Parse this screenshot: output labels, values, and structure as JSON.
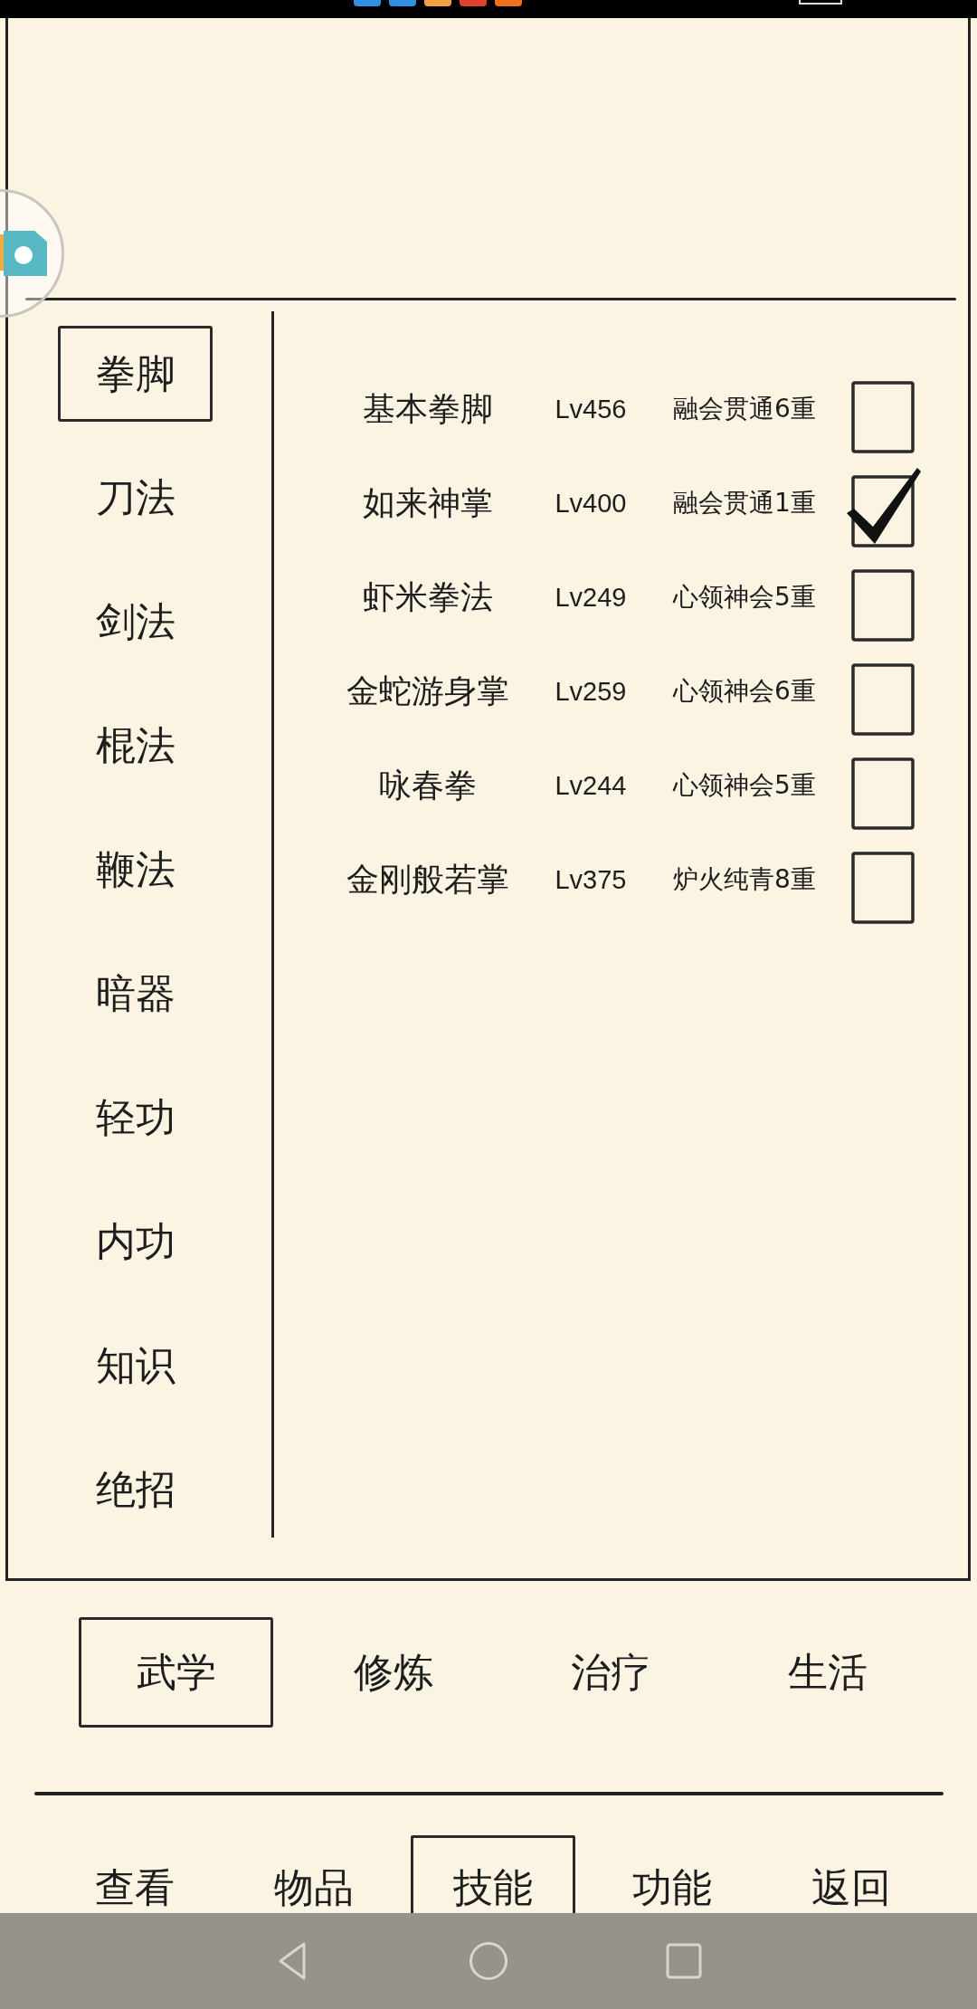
{
  "sidebar": {
    "items": [
      {
        "label": "拳脚",
        "selected": true
      },
      {
        "label": "刀法",
        "selected": false
      },
      {
        "label": "剑法",
        "selected": false
      },
      {
        "label": "棍法",
        "selected": false
      },
      {
        "label": "鞭法",
        "selected": false
      },
      {
        "label": "暗器",
        "selected": false
      },
      {
        "label": "轻功",
        "selected": false
      },
      {
        "label": "内功",
        "selected": false
      },
      {
        "label": "知识",
        "selected": false
      },
      {
        "label": "绝招",
        "selected": false
      }
    ]
  },
  "skills": [
    {
      "name": "基本拳脚",
      "grade": "Lv456",
      "mastery": "融会贯通6重",
      "checked": false
    },
    {
      "name": "如来神掌",
      "grade": "Lv400",
      "mastery": "融会贯通1重",
      "checked": true
    },
    {
      "name": "虾米拳法",
      "grade": "Lv249",
      "mastery": "心领神会5重",
      "checked": false
    },
    {
      "name": "金蛇游身掌",
      "grade": "Lv259",
      "mastery": "心领神会6重",
      "checked": false
    },
    {
      "name": "咏春拳",
      "grade": "Lv244",
      "mastery": "心领神会5重",
      "checked": false
    },
    {
      "name": "金刚般若掌",
      "grade": "Lv375",
      "mastery": "炉火纯青8重",
      "checked": false
    }
  ],
  "category_tabs": [
    {
      "label": "武学",
      "selected": true
    },
    {
      "label": "修炼",
      "selected": false
    },
    {
      "label": "治疗",
      "selected": false
    },
    {
      "label": "生活",
      "selected": false
    }
  ],
  "bottom_nav": [
    {
      "label": "查看",
      "selected": false
    },
    {
      "label": "物品",
      "selected": false
    },
    {
      "label": "技能",
      "selected": true
    },
    {
      "label": "功能",
      "selected": false
    },
    {
      "label": "返回",
      "selected": false
    }
  ]
}
